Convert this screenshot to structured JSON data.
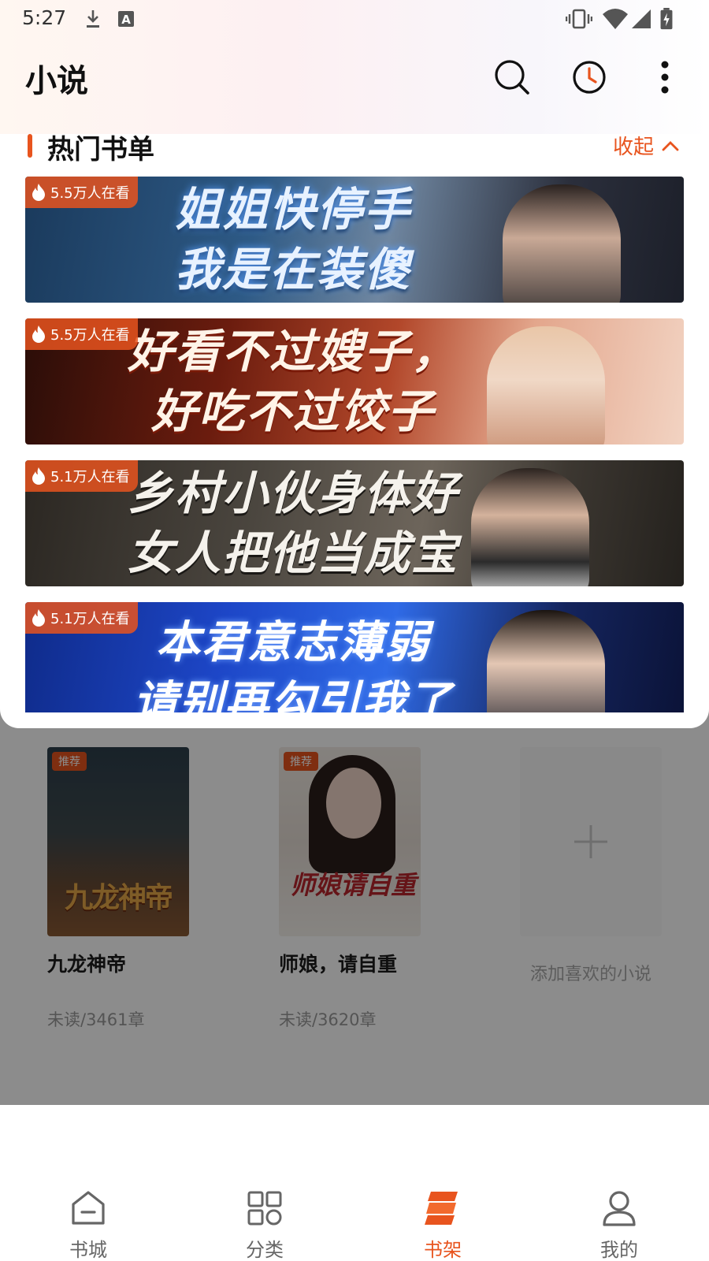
{
  "status_bar": {
    "time": "5:27"
  },
  "app_bar": {
    "title": "小说",
    "icons": [
      "search-icon",
      "history-clock-icon",
      "more-vert-icon"
    ]
  },
  "hot_booklist": {
    "title": "热门书单",
    "collapse_label": "收起",
    "banners": [
      {
        "heat": "5.5万人在看",
        "line1": "姐姐快停手",
        "line2": "我是在装傻"
      },
      {
        "heat": "5.5万人在看",
        "line1": "好看不过嫂子，",
        "line2": "好吃不过饺子"
      },
      {
        "heat": "5.1万人在看",
        "line1": "乡村小伙身体好",
        "line2": "女人把他当成宝"
      },
      {
        "heat": "5.1万人在看",
        "line1": "本君意志薄弱",
        "line2": "请别再勾引我了"
      }
    ]
  },
  "bookshelf": {
    "books": [
      {
        "tag": "推荐",
        "cover_title": "九龙神帝",
        "title": "九龙神帝",
        "progress": "未读/3461章"
      },
      {
        "tag": "推荐",
        "cover_title": "师娘请自重",
        "title": "师娘，请自重",
        "progress": "未读/3620章"
      }
    ],
    "add_label": "添加喜欢的小说"
  },
  "bottom_nav": {
    "items": [
      {
        "label": "书城",
        "icon": "home-icon"
      },
      {
        "label": "分类",
        "icon": "grid-icon"
      },
      {
        "label": "书架",
        "icon": "bookshelf-icon",
        "active": true
      },
      {
        "label": "我的",
        "icon": "profile-icon"
      }
    ]
  },
  "colors": {
    "accent": "#e8541e",
    "dim_overlay": "rgba(0,0,0,0.45)"
  }
}
